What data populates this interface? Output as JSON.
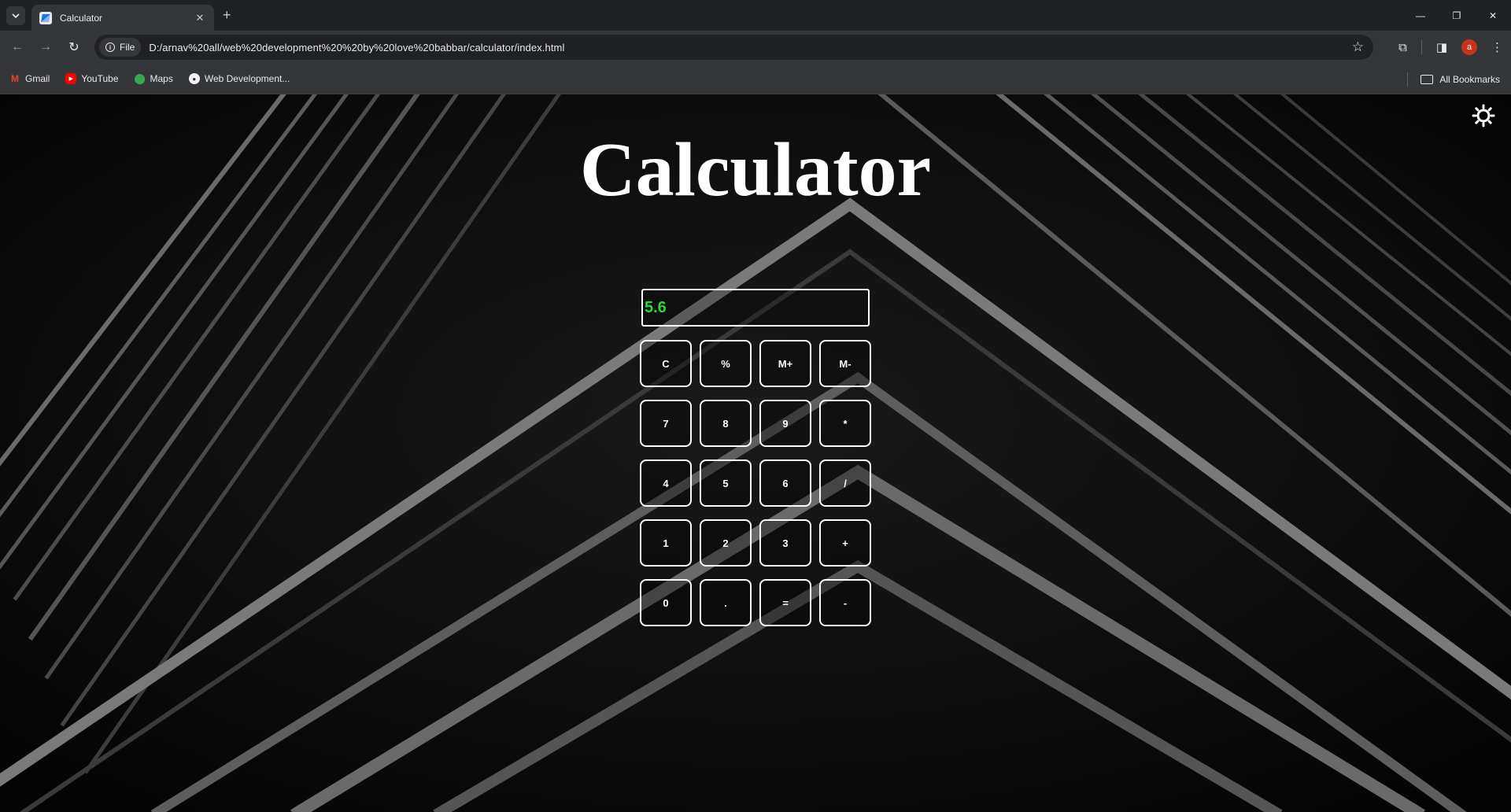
{
  "browser": {
    "tab": {
      "title": "Calculator"
    },
    "address": {
      "chip": "File",
      "url": "D:/arnav%20all/web%20development%20%20by%20love%20babbar/calculator/index.html"
    },
    "profile_initial": "a",
    "bookmarks": [
      {
        "label": "Gmail",
        "icon": "gmail-icon"
      },
      {
        "label": "YouTube",
        "icon": "youtube-icon"
      },
      {
        "label": "Maps",
        "icon": "maps-icon"
      },
      {
        "label": "Web Development...",
        "icon": "web-development-icon"
      }
    ],
    "all_bookmarks": "All Bookmarks"
  },
  "page": {
    "title": "Calculator",
    "display_value": "5.6",
    "display_color": "#2fd82f",
    "theme_toggle_icon": "sun-icon",
    "keys": [
      [
        "C",
        "%",
        "M+",
        "M-"
      ],
      [
        "7",
        "8",
        "9",
        "*"
      ],
      [
        "4",
        "5",
        "6",
        "/"
      ],
      [
        "1",
        "2",
        "3",
        "+"
      ],
      [
        "0",
        ".",
        "=",
        "-"
      ]
    ]
  }
}
